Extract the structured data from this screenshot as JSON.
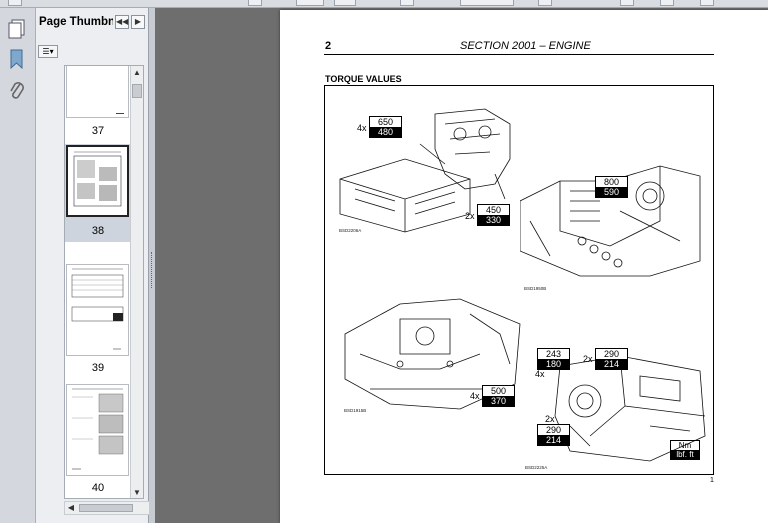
{
  "thumbnails_panel": {
    "title": "Page Thumbna...",
    "buttons": {
      "options_glyph": "☰▾",
      "collapse": "◀◀",
      "next": "▶"
    },
    "pages": [
      {
        "label": "37",
        "selected": false
      },
      {
        "label": "38",
        "selected": true
      },
      {
        "label": "39",
        "selected": false
      },
      {
        "label": "40",
        "selected": false
      }
    ]
  },
  "rail": {
    "icons": [
      "pages-icon",
      "bookmark-icon",
      "attachment-icon"
    ]
  },
  "document": {
    "page_number": "2",
    "section_title": "SECTION 2001 – ENGINE",
    "heading": "TORQUE VALUES",
    "footer_page": "1",
    "figures": [
      {
        "caption": "BSD2206A"
      },
      {
        "caption": "BSD1950B"
      },
      {
        "caption": "BSD1915B"
      },
      {
        "caption": "BSD2225A"
      }
    ],
    "torque_labels": [
      {
        "mult": "4x",
        "nm": "650",
        "lbf": "480"
      },
      {
        "mult": "2x",
        "nm": "450",
        "lbf": "330"
      },
      {
        "mult": "",
        "nm": "800",
        "lbf": "590"
      },
      {
        "mult": "4x",
        "nm": "500",
        "lbf": "370"
      },
      {
        "mult": "4x",
        "nm": "243",
        "lbf": "180"
      },
      {
        "mult": "2x",
        "nm": "290",
        "lbf": "214"
      },
      {
        "mult": "2x",
        "nm": "290",
        "lbf": "214"
      }
    ],
    "legend": {
      "nm": "Nm",
      "lbf": "lbf. ft"
    }
  },
  "colors": {
    "workspace": "#6e6e6e",
    "panel": "#eceef1",
    "selected_thumb": "#cdd4dd"
  }
}
